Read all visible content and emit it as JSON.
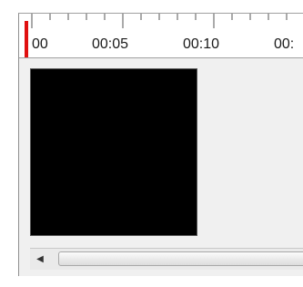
{
  "timeline": {
    "ruler": {
      "labels": [
        "00",
        "00:05",
        "00:10",
        "00:"
      ]
    },
    "playhead": {
      "color": "#e01010"
    },
    "scrollbar": {
      "left_arrow_icon": "triangle-left-icon",
      "left_arrow_glyph": "◀"
    }
  }
}
